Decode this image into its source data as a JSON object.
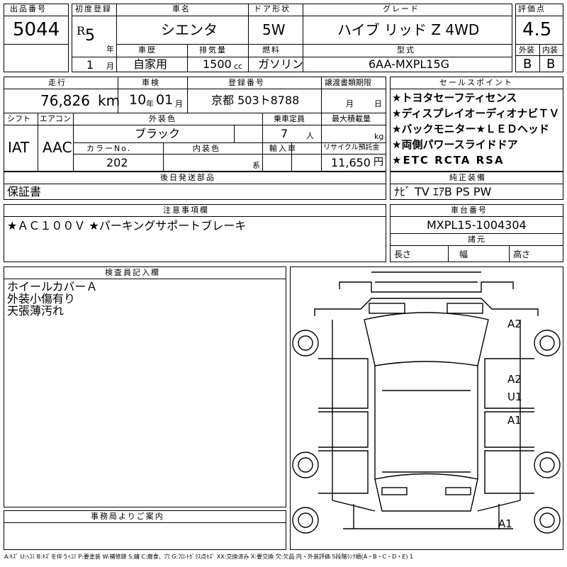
{
  "lot": {
    "label": "出品番号",
    "value": "5044"
  },
  "first_reg": {
    "label": "初度登録",
    "era": "R",
    "year": "5",
    "year_unit": "年",
    "month": "1",
    "month_unit": "月"
  },
  "car_name": {
    "label": "車名",
    "value": "シエンタ"
  },
  "door": {
    "label": "ドア形状",
    "value": "5W"
  },
  "grade": {
    "label": "グレード",
    "value": "ハイブ リッド Z 4WD"
  },
  "score": {
    "label": "評価点",
    "value": "4.5"
  },
  "history": {
    "label": "車歴",
    "value": "自家用"
  },
  "displacement": {
    "label": "排気量",
    "value": "1500",
    "unit": "cc"
  },
  "fuel": {
    "label": "燃料",
    "value": "ガソリン"
  },
  "model": {
    "label": "型式",
    "value": "6AA-MXPL15G"
  },
  "ext_grade": {
    "label": "外装",
    "value": "B"
  },
  "int_grade": {
    "label": "内装",
    "value": "B"
  },
  "mileage": {
    "label": "走行",
    "value": "76,826",
    "unit": "km"
  },
  "inspection": {
    "label": "車検",
    "year": "10",
    "year_unit": "年",
    "month": "01",
    "month_unit": "月"
  },
  "reg_no": {
    "label": "登録番号",
    "value": "京都 503ト8788"
  },
  "transfer": {
    "label": "譲渡書類期限",
    "month_unit": "月",
    "day_unit": "日"
  },
  "sales_points": {
    "label": "セールスポイント",
    "items": [
      "★トヨタセーフティセンス",
      "★ディスプレイオーディオナビＴＶ",
      "★バックモニター★ＬＥＤヘッド",
      "★両側パワースライドドア",
      "★ETC RCTA RSA"
    ]
  },
  "shift": {
    "label": "シフト",
    "value": "IAT"
  },
  "aircon": {
    "label": "エアコン",
    "value": "AAC"
  },
  "ext_color": {
    "label": "外装色",
    "value": "ブラック"
  },
  "capacity": {
    "label": "乗車定員",
    "value": "7",
    "unit": "人"
  },
  "max_load": {
    "label": "最大積載量",
    "unit": "kg"
  },
  "color_no": {
    "label": "カラーNo.",
    "value": "202"
  },
  "int_color": {
    "label": "内装色",
    "unit": "系"
  },
  "import": {
    "label": "輸入車"
  },
  "recycle": {
    "label": "リサイクル預託金",
    "value": "11,650",
    "unit": "円"
  },
  "later_parts": {
    "label": "後日発送部品",
    "value": "保証書"
  },
  "genuine": {
    "label": "純正装備",
    "value": "ﾅﾋﾞ TV ｴｱB PS PW"
  },
  "notes": {
    "label": "注意事項欄",
    "value": "★ＡＣ１００Ｖ ★パーキングサポートブレーキ"
  },
  "chassis": {
    "label": "車台番号",
    "value": "MXPL15-1004304"
  },
  "dims": {
    "label": "諸元",
    "length": "長さ",
    "width": "幅",
    "height": "高さ"
  },
  "inspector": {
    "label": "検査員記入欄",
    "lines": [
      "ホイールカバーＡ",
      "外装小傷有り",
      "天張薄汚れ"
    ]
  },
  "office": {
    "label": "事務局よりご案内"
  },
  "diagram_marks": [
    "A2",
    "A2",
    "U1",
    "A1",
    "A1"
  ],
  "legend": "A:ｷｽﾞ U:ﾍｺﾐ B:ｷｽﾞを伴うﾍｺﾐ P:要塗装 W:補修跡 S:錆 C:腐食、穴 G:ﾌﾛﾝﾄｶﾞﾗｽ点ｷｽﾞ XX:交換済み X:要交換 欠:欠品 内・外装評価 5段階ﾗﾝｸ順(A・B・C・D・E) 1"
}
